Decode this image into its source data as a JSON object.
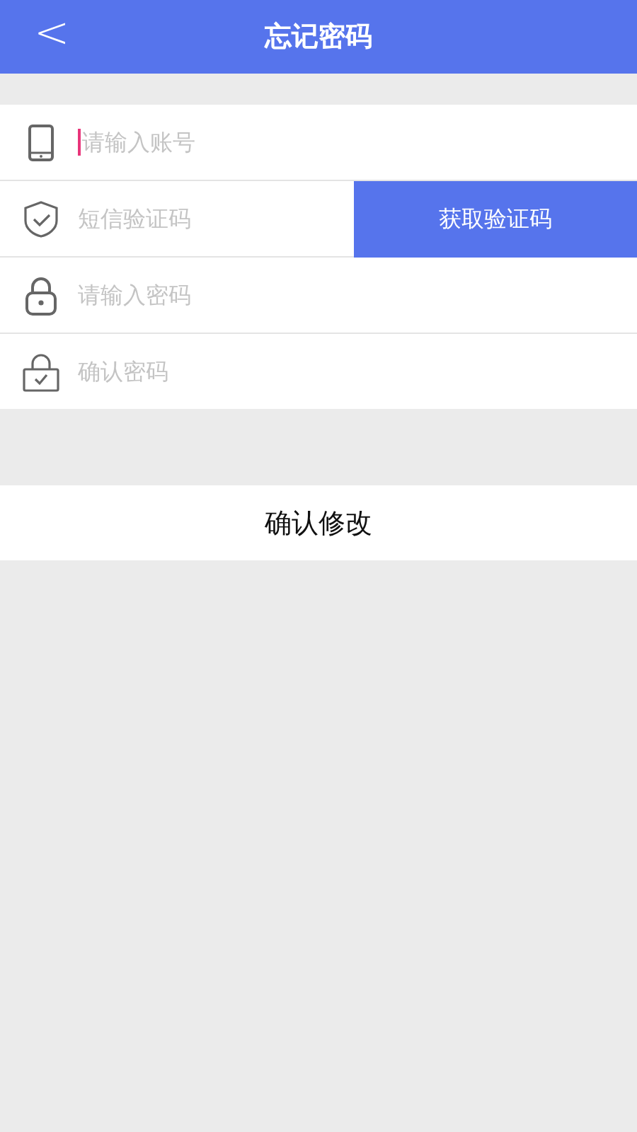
{
  "header": {
    "back": "<",
    "title": "忘记密码"
  },
  "fields": [
    {
      "kind": "phone",
      "placeholder": "请输入账号",
      "focused": true
    },
    {
      "kind": "shield",
      "placeholder": "短信验证码",
      "focused": false,
      "action": "获取验证码"
    },
    {
      "kind": "lock",
      "placeholder": "请输入密码",
      "focused": false
    },
    {
      "kind": "lock-check",
      "placeholder": "确认密码",
      "focused": false
    }
  ],
  "submit": "确认修改"
}
